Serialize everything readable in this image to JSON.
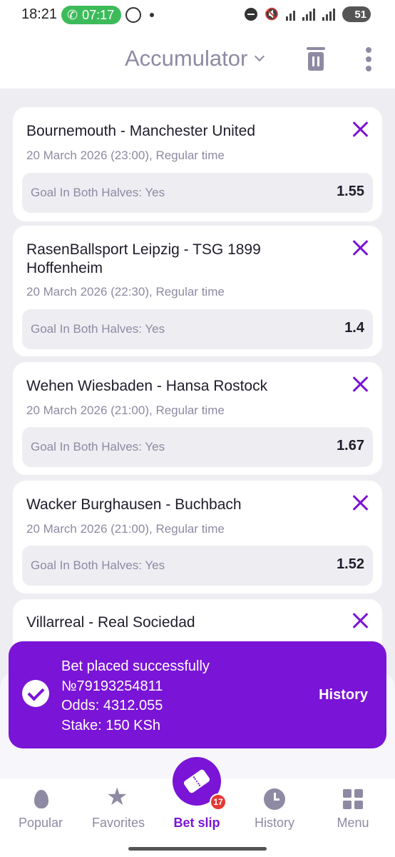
{
  "status_bar": {
    "time": "18:21",
    "call_timer": "07:17",
    "battery": "51"
  },
  "header": {
    "title": "Accumulator"
  },
  "bets": [
    {
      "match": "Bournemouth - Manchester United",
      "date": "20 March 2026 (23:00), Regular time",
      "market": "Goal In Both Halves: Yes",
      "odds": "1.55"
    },
    {
      "match": "RasenBallsport Leipzig - TSG 1899 Hoffenheim",
      "date": "20 March 2026 (22:30), Regular time",
      "market": "Goal In Both Halves: Yes",
      "odds": "1.4"
    },
    {
      "match": "Wehen Wiesbaden - Hansa Rostock",
      "date": "20 March 2026 (21:00), Regular time",
      "market": "Goal In Both Halves: Yes",
      "odds": "1.67"
    },
    {
      "match": "Wacker Burghausen - Buchbach",
      "date": "20 March 2026 (21:00), Regular time",
      "market": "Goal In Both Halves: Yes",
      "odds": "1.52"
    },
    {
      "match": "Villarreal - Real Sociedad"
    }
  ],
  "toast": {
    "line1": "Bet placed successfully",
    "line2": "№79193254811",
    "line3": "Odds: 4312.055",
    "line4": "Stake: 150 KSh",
    "action": "History"
  },
  "nav": {
    "items": [
      {
        "label": "Popular",
        "icon": "flame-icon"
      },
      {
        "label": "Favorites",
        "icon": "star-icon"
      },
      {
        "label": "Bet slip",
        "icon": "ticket-icon",
        "badge": "17"
      },
      {
        "label": "History",
        "icon": "clock-icon"
      },
      {
        "label": "Menu",
        "icon": "grid-icon"
      }
    ]
  },
  "colors": {
    "accent": "#7a14d6",
    "badge": "#e53935",
    "muted": "#8e8aa3"
  }
}
